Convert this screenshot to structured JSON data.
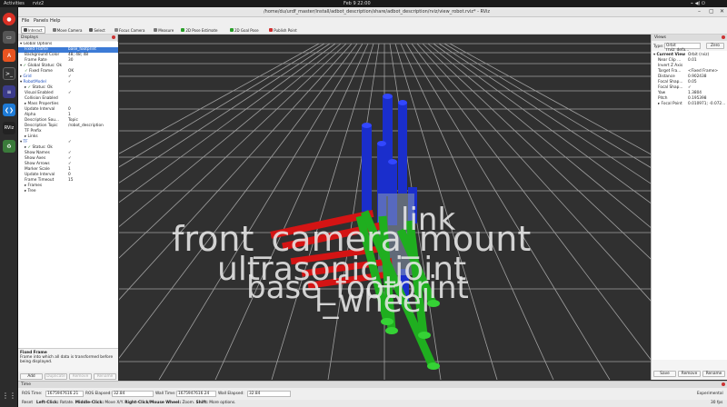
{
  "desktop": {
    "activities": "Activities",
    "app_name": "rviz2",
    "clock": "Feb 9  22:00"
  },
  "window": {
    "title": "/home/du/urdf_master/install/adbot_description/share/adbot_description/rviz/view_robot.rviz* - RViz"
  },
  "menu": [
    "File",
    "Panels",
    "Help"
  ],
  "toolbar": [
    {
      "label": "Interact",
      "icon": "cursor-icon",
      "color": "#4a4a4a",
      "active": true
    },
    {
      "label": "Move Camera",
      "icon": "move-camera-icon",
      "color": "#777777"
    },
    {
      "label": "Select",
      "icon": "select-icon",
      "color": "#5a5a5a"
    },
    {
      "label": "Focus Camera",
      "icon": "focus-camera-icon",
      "color": "#888888"
    },
    {
      "label": "Measure",
      "icon": "measure-icon",
      "color": "#777777"
    },
    {
      "label": "2D Pose Estimate",
      "icon": "pose-estimate-icon",
      "color": "#2aa02a"
    },
    {
      "label": "2D Goal Pose",
      "icon": "goal-pose-icon",
      "color": "#2aa02a"
    },
    {
      "label": "Publish Point",
      "icon": "publish-point-icon",
      "color": "#d03030"
    }
  ],
  "displays": {
    "title": "Displays",
    "rows": [
      {
        "indent": 0,
        "label": "Global Options",
        "arrow": "▾"
      },
      {
        "indent": 1,
        "label": "Fixed Frame",
        "value": "base_footprint",
        "selected": true
      },
      {
        "indent": 1,
        "label": "Background Color",
        "value": "48; 48; 48"
      },
      {
        "indent": 1,
        "label": "Frame Rate",
        "value": "30"
      },
      {
        "indent": 0,
        "label": "Global Status: Ok",
        "arrow": "▾",
        "check": "✓"
      },
      {
        "indent": 1,
        "label": "Fixed Frame",
        "value": "OK",
        "check": "✓"
      },
      {
        "indent": 0,
        "label": "Grid",
        "arrow": "▸",
        "blue": true,
        "value": "✓"
      },
      {
        "indent": 0,
        "label": "RobotModel",
        "arrow": "▾",
        "blue": true,
        "value": "✓"
      },
      {
        "indent": 1,
        "label": "Status: Ok",
        "arrow": "▸",
        "check": "✓"
      },
      {
        "indent": 1,
        "label": "Visual Enabled",
        "value": "✓"
      },
      {
        "indent": 1,
        "label": "Collision Enabled",
        "value": ""
      },
      {
        "indent": 1,
        "label": "Mass Properties",
        "arrow": "▸"
      },
      {
        "indent": 1,
        "label": "Update Interval",
        "value": "0"
      },
      {
        "indent": 1,
        "label": "Alpha",
        "value": "1"
      },
      {
        "indent": 1,
        "label": "Description Sou...",
        "value": "Topic"
      },
      {
        "indent": 1,
        "label": "Description Topic",
        "value": "/robot_description"
      },
      {
        "indent": 1,
        "label": "TF Prefix",
        "value": ""
      },
      {
        "indent": 1,
        "label": "Links",
        "arrow": "▸"
      },
      {
        "indent": 0,
        "label": "TF",
        "arrow": "▾",
        "blue": true,
        "value": "✓"
      },
      {
        "indent": 1,
        "label": "Status: Ok",
        "arrow": "▸",
        "check": "✓"
      },
      {
        "indent": 1,
        "label": "Show Names",
        "value": "✓"
      },
      {
        "indent": 1,
        "label": "Show Axes",
        "value": "✓"
      },
      {
        "indent": 1,
        "label": "Show Arrows",
        "value": "✓"
      },
      {
        "indent": 1,
        "label": "Marker Scale",
        "value": "1"
      },
      {
        "indent": 1,
        "label": "Update Interval",
        "value": "0"
      },
      {
        "indent": 1,
        "label": "Frame Timeout",
        "value": "15"
      },
      {
        "indent": 1,
        "label": "Frames",
        "arrow": "▸"
      },
      {
        "indent": 1,
        "label": "Tree",
        "arrow": "▸"
      }
    ],
    "desc_title": "Fixed Frame",
    "desc_text": "Frame into which all data is transformed before being displayed.",
    "buttons": [
      {
        "label": "Add",
        "disabled": false
      },
      {
        "label": "Duplicate",
        "disabled": true
      },
      {
        "label": "Remove",
        "disabled": true
      },
      {
        "label": "Rename",
        "disabled": true
      }
    ]
  },
  "views": {
    "title": "Views",
    "type_label": "Type:",
    "type_value": "Orbit (rviz_defa...",
    "zero_button": "Zero",
    "rows": [
      {
        "indent": 0,
        "label": "Current View",
        "value": "Orbit (rviz)",
        "arrow": "▾"
      },
      {
        "indent": 1,
        "label": "Near Clip ...",
        "value": "0.01"
      },
      {
        "indent": 1,
        "label": "Invert Z Axis",
        "value": ""
      },
      {
        "indent": 1,
        "label": "Target Fra...",
        "value": "<Fixed Frame>"
      },
      {
        "indent": 1,
        "label": "Distance",
        "value": "0.902438"
      },
      {
        "indent": 1,
        "label": "Focal Shap...",
        "value": "0.05"
      },
      {
        "indent": 1,
        "label": "Focal Shap...",
        "value": "✓"
      },
      {
        "indent": 1,
        "label": "Yaw",
        "value": "1.3804"
      },
      {
        "indent": 1,
        "label": "Pitch",
        "value": "0.195398"
      },
      {
        "indent": 1,
        "label": "Focal Point",
        "value": "0.010971; -0.072...",
        "arrow": "▸"
      }
    ],
    "buttons": [
      "Save",
      "Remove",
      "Rename"
    ]
  },
  "time": {
    "title": "Time",
    "ros_time_label": "ROS Time:",
    "ros_time": "1675947616.21",
    "ros_elapsed_label": "ROS Elapsed:",
    "ros_elapsed": "32.84",
    "wall_time_label": "Wall Time:",
    "wall_time": "1675947616.24",
    "wall_elapsed_label": "Wall Elapsed:",
    "wall_elapsed": "32.84",
    "experimental": "Experimental"
  },
  "status": {
    "reset": "Reset",
    "hint_bold1": "Left-Click:",
    "hint1": " Rotate. ",
    "hint_bold2": "Middle-Click:",
    "hint2": " Move X/Y. ",
    "hint_bold3": "Right-Click/Mouse Wheel:",
    "hint3": " Zoom. ",
    "hint_bold4": "Shift:",
    "hint4": " More options.",
    "fps": "30 fps"
  },
  "scene": {
    "grid_color": "#a0a0a0",
    "bg_color": "#303030",
    "labels": [
      "link",
      "front_camera_mount",
      "ultrasonic_joint",
      "base_footprint",
      "l_wheel"
    ]
  }
}
